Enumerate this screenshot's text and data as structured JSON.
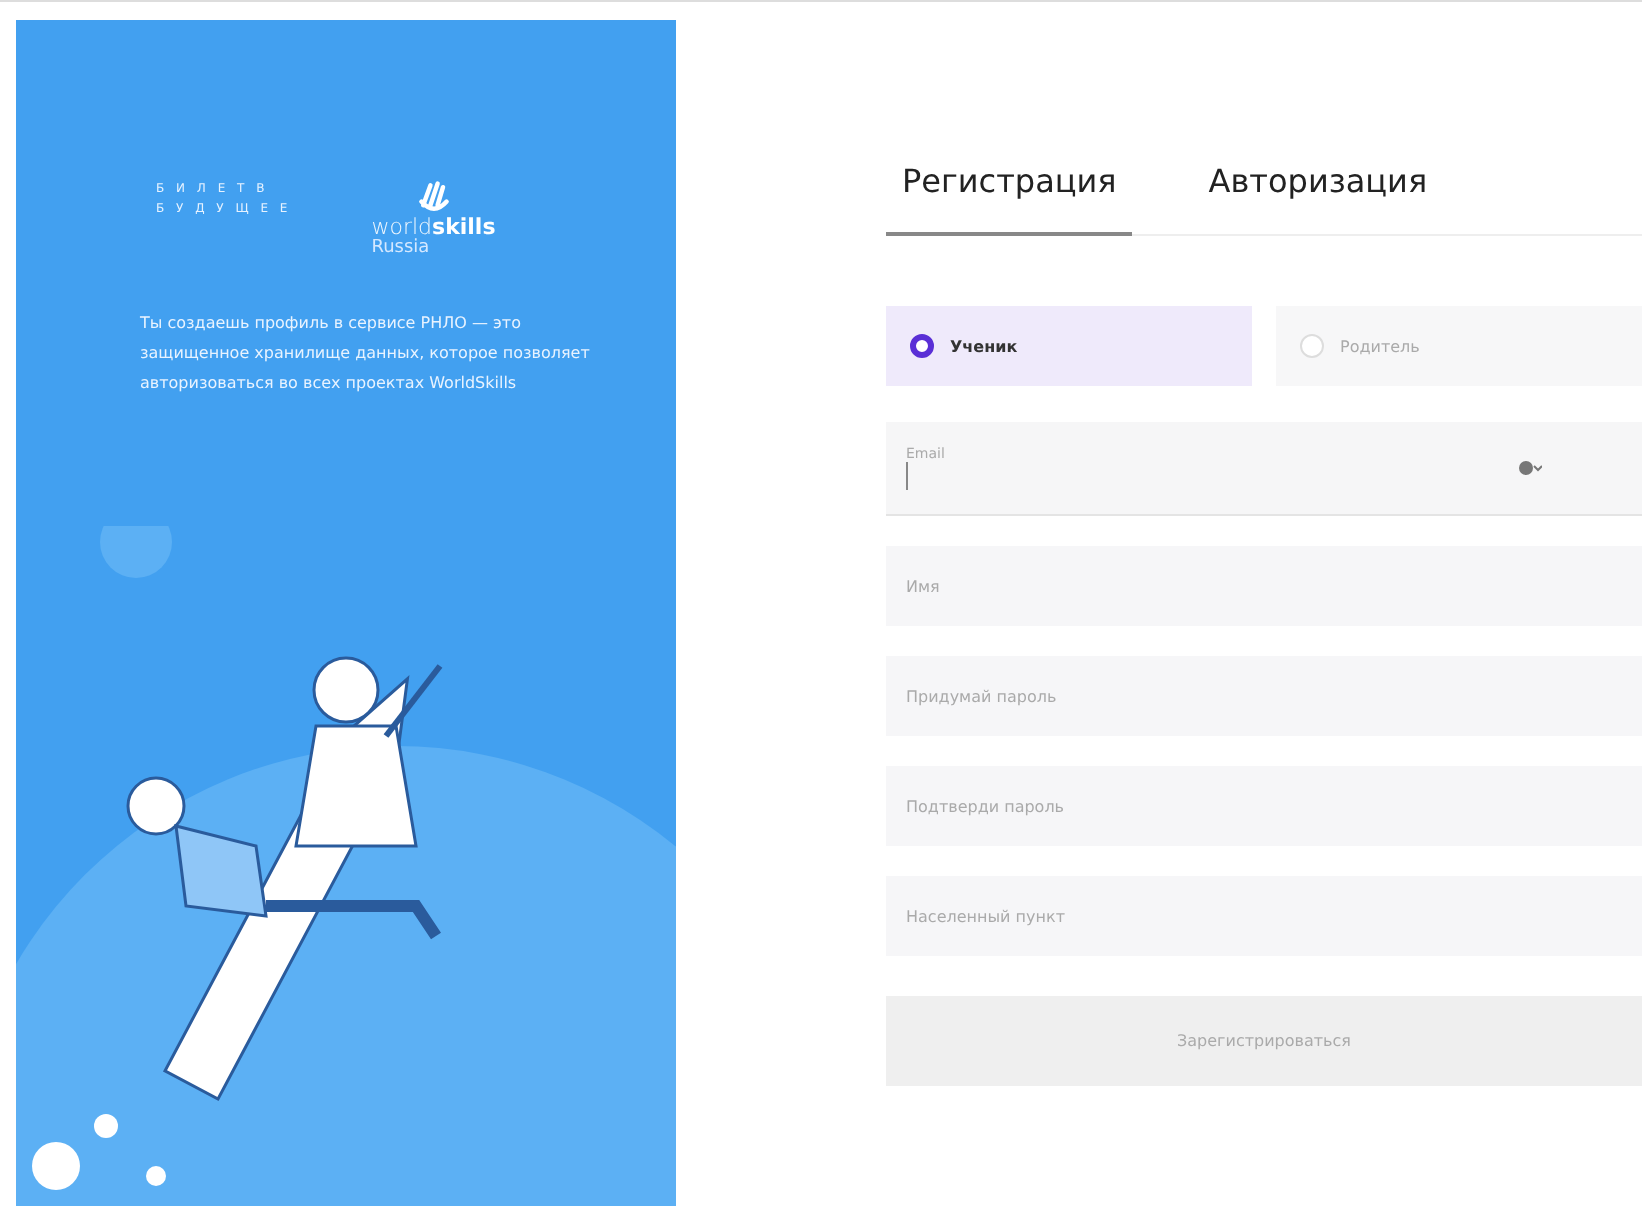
{
  "promo": {
    "logo_left": [
      "Б И Л Е Т  В",
      "Б У Д У Щ Е Е"
    ],
    "logo_right": {
      "word_light": "world",
      "word_bold": "skills",
      "sub": "Russia"
    },
    "text": "Ты создаешь профиль в сервисе РНЛО — это защищенное хранилище данных, которое позволяет авторизоваться во всех проектах WorldSkills"
  },
  "tabs": [
    {
      "label": "Регистрация",
      "selected": true
    },
    {
      "label": "Авторизация",
      "selected": false
    }
  ],
  "roles": [
    {
      "label": "Ученик",
      "selected": true
    },
    {
      "label": "Родитель",
      "selected": false
    }
  ],
  "email": {
    "label": "Email"
  },
  "fields": [
    {
      "placeholder": "Имя"
    },
    {
      "placeholder": "Придумай пароль"
    },
    {
      "placeholder": "Подтверди пароль"
    },
    {
      "placeholder": "Населенный пункт"
    }
  ],
  "submit": {
    "label": "Зарегистрироваться",
    "disabled": true
  }
}
